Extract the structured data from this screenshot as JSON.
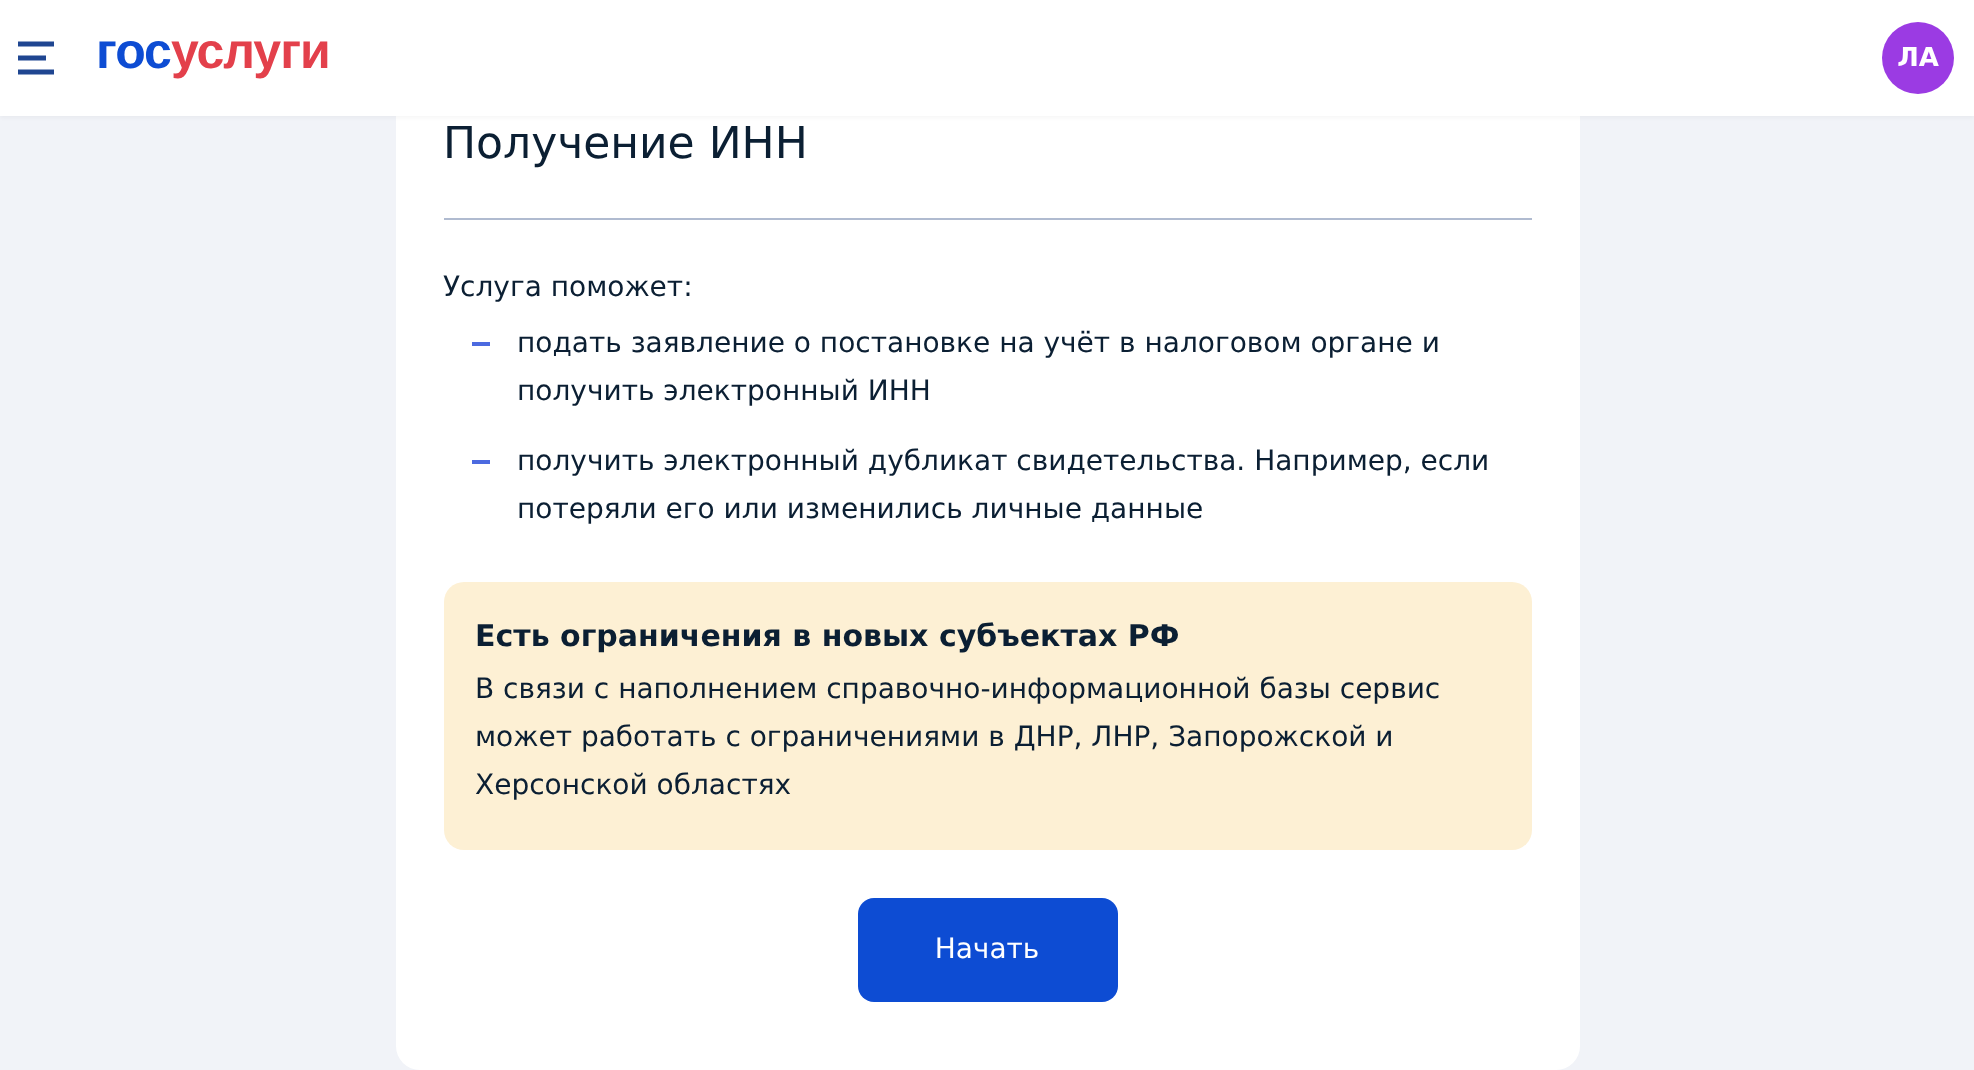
{
  "header": {
    "logo": [
      {
        "text": "гос",
        "color": "#0d4cd3"
      },
      {
        "text": "услуги",
        "color": "#e3404b"
      }
    ],
    "avatar": "ЛА"
  },
  "card": {
    "title": "Получение ИНН",
    "intro": "Услуга поможет:",
    "items": [
      "подать заявление о постановке на учёт в налоговом органе и получить электронный ИНН",
      "получить электронный дубликат свидетельства. Например, если потеряли его или изменились личные данные"
    ],
    "notice": {
      "title": "Есть ограничения в новых субъектах РФ",
      "text": "В связи с наполнением справочно-информационной базы сервис может работать с ограничениями в ДНР, ЛНР, Запорожской и Херсонской областях"
    },
    "button": "Начать"
  }
}
